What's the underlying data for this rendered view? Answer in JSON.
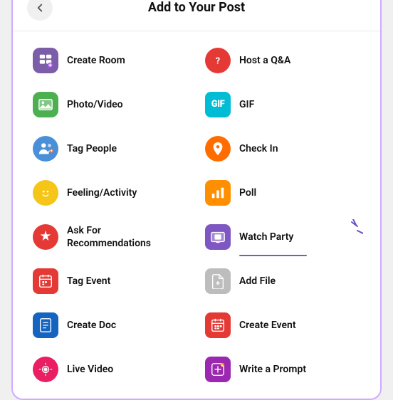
{
  "header": {
    "title": "Add to Your Post",
    "back_label": "←"
  },
  "items": [
    {
      "id": "create-room",
      "label": "Create Room",
      "icon_color": "icon-purple",
      "icon": "➕🎥",
      "col": 0
    },
    {
      "id": "host-qa",
      "label": "Host a Q&A",
      "icon_color": "icon-qa",
      "icon": "❓",
      "col": 1
    },
    {
      "id": "photo-video",
      "label": "Photo/Video",
      "icon_color": "icon-green",
      "icon": "🖼️",
      "col": 0
    },
    {
      "id": "gif",
      "label": "GIF",
      "icon_color": "icon-gif",
      "icon": "GIF",
      "col": 1
    },
    {
      "id": "tag-people",
      "label": "Tag People",
      "icon_color": "icon-blue",
      "icon": "👤",
      "col": 0
    },
    {
      "id": "check-in",
      "label": "Check In",
      "icon_color": "icon-orange",
      "icon": "📍",
      "col": 1
    },
    {
      "id": "feeling-activity",
      "label": "Feeling/Activity",
      "icon_color": "icon-yellow",
      "icon": "😊",
      "col": 0
    },
    {
      "id": "poll",
      "label": "Poll",
      "icon_color": "icon-bar",
      "icon": "📊",
      "col": 1
    },
    {
      "id": "ask-recommendations",
      "label": "Ask For\nRecommendations",
      "icon_color": "icon-red",
      "icon": "⭐",
      "col": 0
    },
    {
      "id": "watch-party",
      "label": "Watch Party",
      "icon_color": "icon-watch",
      "icon": "📺",
      "col": 1,
      "highlighted": true
    },
    {
      "id": "tag-event",
      "label": "Tag Event",
      "icon_color": "icon-event",
      "icon": "📅",
      "col": 0
    },
    {
      "id": "add-file",
      "label": "Add File",
      "icon_color": "icon-file",
      "icon": "📄",
      "col": 1
    },
    {
      "id": "create-doc",
      "label": "Create Doc",
      "icon_color": "icon-dark-blue",
      "icon": "📝",
      "col": 0
    },
    {
      "id": "create-event",
      "label": "Create Event",
      "icon_color": "icon-event",
      "icon": "📅",
      "col": 1
    },
    {
      "id": "live-video",
      "label": "Live Video",
      "icon_color": "icon-pink-red",
      "icon": "🎥",
      "col": 0
    },
    {
      "id": "write-prompt",
      "label": "Write a Prompt",
      "icon_color": "icon-prompt",
      "icon": "✏️",
      "col": 1
    }
  ]
}
